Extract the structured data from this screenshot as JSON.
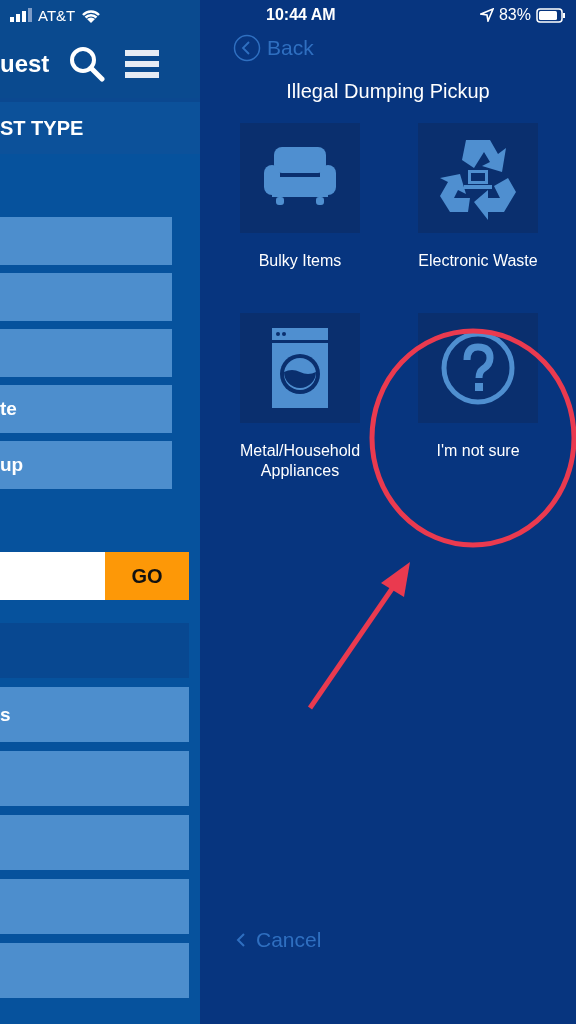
{
  "status_bar": {
    "carrier": "AT&T",
    "time": "10:44 AM",
    "battery": "83%"
  },
  "left_panel": {
    "header_title": "uest",
    "section_title": "ST TYPE",
    "type_buttons": [
      {
        "kind": "blank"
      },
      {
        "kind": "blank"
      },
      {
        "kind": "blank"
      },
      {
        "kind": "labeled",
        "label": "te"
      },
      {
        "kind": "labeled",
        "label": "up"
      }
    ],
    "search": {
      "button": "GO"
    },
    "list_buttons": [
      {
        "kind": "labeled",
        "label": "s"
      },
      {
        "kind": "blank"
      },
      {
        "kind": "blank"
      },
      {
        "kind": "blank"
      },
      {
        "kind": "blank"
      }
    ]
  },
  "right_panel": {
    "back": "Back",
    "title": "Illegal Dumping Pickup",
    "tiles": [
      {
        "kind": "sofa",
        "label": "Bulky Items"
      },
      {
        "kind": "recycle",
        "label": "Electronic Waste"
      },
      {
        "kind": "washer",
        "label": "Metal/Household Appliances"
      },
      {
        "kind": "question",
        "label": "I'm not sure"
      }
    ],
    "cancel": "Cancel"
  }
}
